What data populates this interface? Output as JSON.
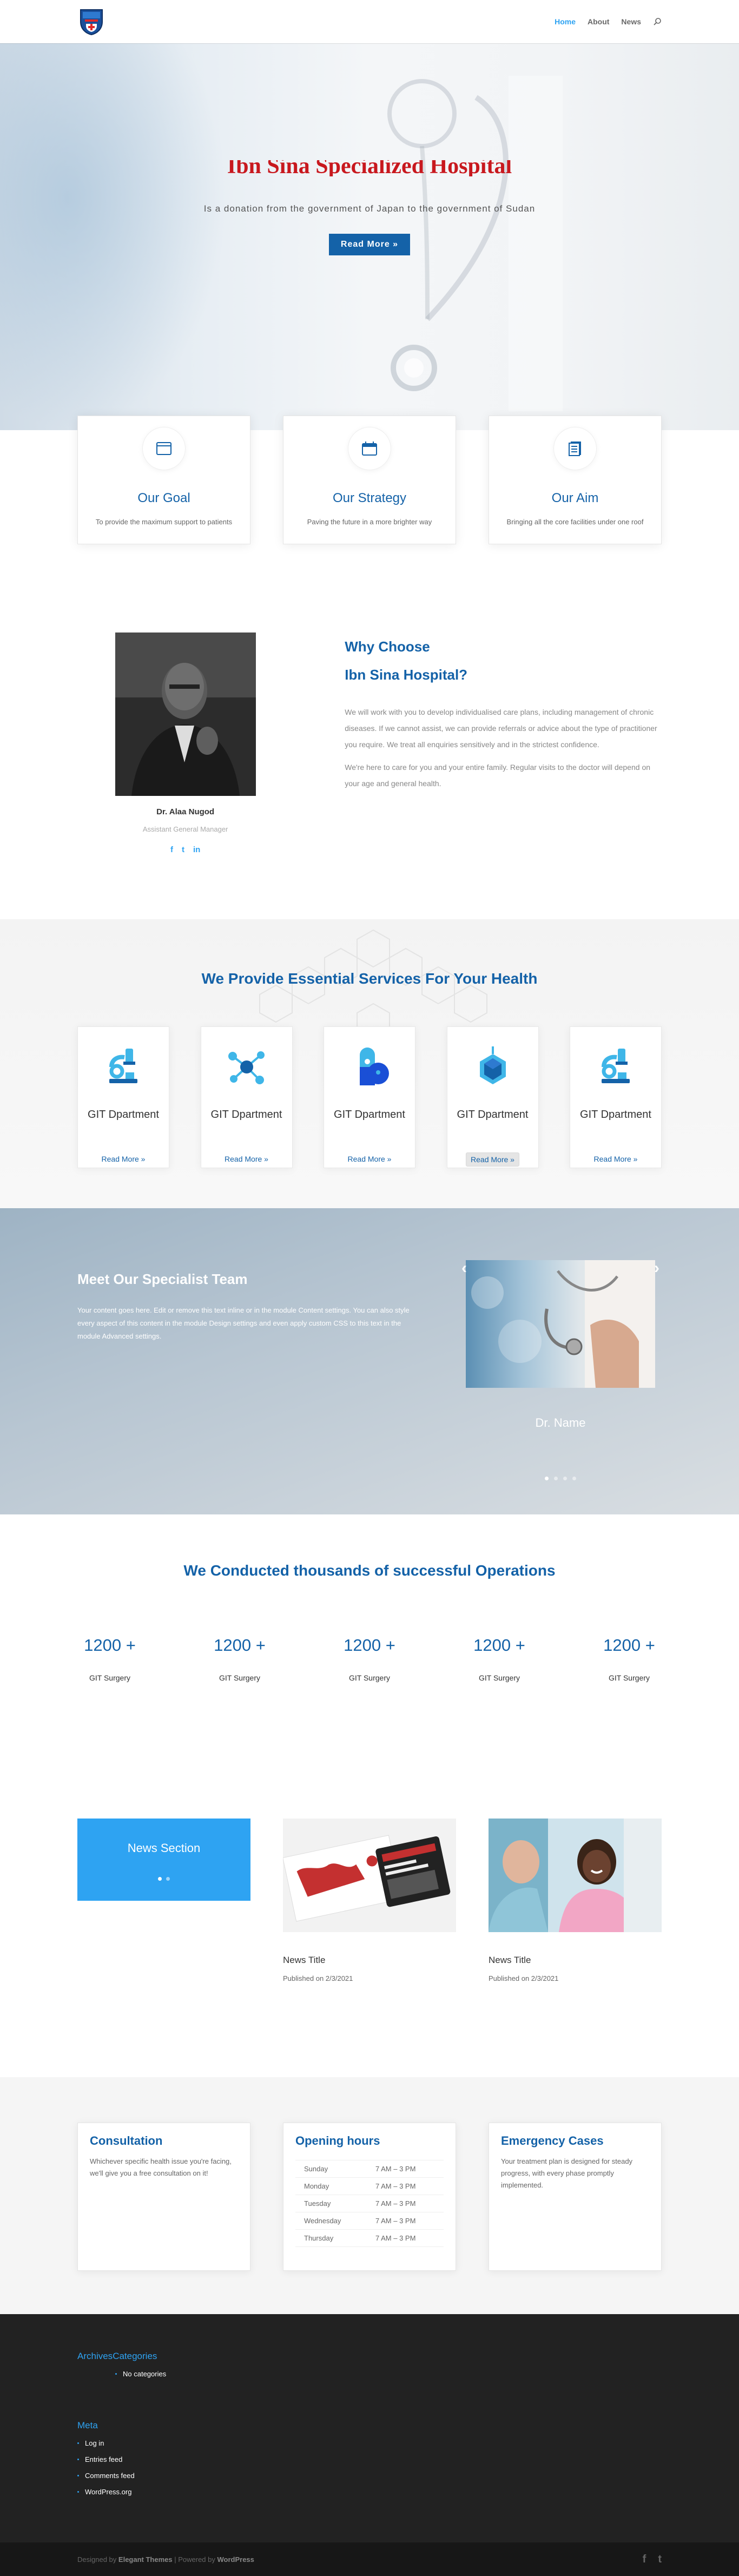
{
  "colors": {
    "primary": "#1462a8",
    "accent": "#2ea3f2",
    "hero_title": "#c8181e"
  },
  "header": {
    "logo_icon": "hospital-crest-logo",
    "nav": [
      {
        "label": "Home",
        "active": true
      },
      {
        "label": "About",
        "active": false
      },
      {
        "label": "News",
        "active": false
      }
    ],
    "search_icon": "search-icon"
  },
  "hero": {
    "title": "Ibn Sina Specialized Hospital",
    "subtitle": "Is a donation from the government of Japan to the government of Sudan",
    "button": "Read More »"
  },
  "features": [
    {
      "icon": "window-icon",
      "title": "Our Goal",
      "text": "To provide the maximum support to patients"
    },
    {
      "icon": "calendar-icon",
      "title": "Our Strategy",
      "text": "Paving the future in a more brighter way"
    },
    {
      "icon": "document-icon",
      "title": "Our Aim",
      "text": "Bringing all the core facilities under one roof"
    }
  ],
  "why": {
    "title_line1": "Why Choose",
    "title_line2": "Ibn Sina Hospital?",
    "p1": "We will work with you to develop individualised care plans, including management of chronic diseases. If we cannot assist, we can provide referrals or advice about the type of practitioner you require. We treat all enquiries sensitively and in the strictest confidence.",
    "p2": "We're here to care for you and your entire family. Regular visits to the doctor will depend on your age and general health.",
    "doctor_name": "Dr. Alaa Nugod",
    "doctor_role": "Assistant General Manager",
    "social": [
      "f",
      "t",
      "in"
    ]
  },
  "services": {
    "title": "We Provide Essential Services For Your Health",
    "items": [
      {
        "name": "GIT Dpartment",
        "link": "Read More »",
        "icon": "microscope-icon"
      },
      {
        "name": "GIT Dpartment",
        "link": "Read More »",
        "icon": "molecule-icon"
      },
      {
        "name": "GIT Dpartment",
        "link": "Read More »",
        "icon": "capsule-icon"
      },
      {
        "name": "GIT Dpartment",
        "link": "Read More »",
        "icon": "hexagon-icon"
      },
      {
        "name": "GIT Dpartment",
        "link": "Read More »",
        "icon": "microscope-icon"
      }
    ]
  },
  "team": {
    "title": "Meet Our Specialist Team",
    "text": "Your content goes here. Edit or remove this text inline or in the module Content settings. You can also style every aspect of this content in the module Design settings and even apply custom CSS to this text in the module Advanced settings.",
    "doctor_name": "Dr. Name",
    "prev": "‹",
    "next": "›"
  },
  "stats": {
    "title": "We Conducted thousands of successful Operations",
    "items": [
      {
        "number": "1200 +",
        "label": "GIT Surgery"
      },
      {
        "number": "1200 +",
        "label": "GIT Surgery"
      },
      {
        "number": "1200 +",
        "label": "GIT Surgery"
      },
      {
        "number": "1200 +",
        "label": "GIT Surgery"
      },
      {
        "number": "1200 +",
        "label": "GIT Surgery"
      }
    ]
  },
  "news": {
    "section_title": "News Section",
    "items": [
      {
        "title": "News Title",
        "date": "Published on 2/3/2021"
      },
      {
        "title": "News Title",
        "date": "Published on 2/3/2021"
      }
    ]
  },
  "info": {
    "consultation": {
      "title": "Consultation",
      "text": "Whichever specific health issue you're facing, we'll give you a free consultation on it!"
    },
    "hours": {
      "title": "Opening hours",
      "rows": [
        {
          "day": "Sunday",
          "time": "7 AM – 3 PM"
        },
        {
          "day": "Monday",
          "time": "7 AM – 3 PM"
        },
        {
          "day": "Tuesday",
          "time": "7 AM – 3 PM"
        },
        {
          "day": "Wednesday",
          "time": "7 AM – 3 PM"
        },
        {
          "day": "Thursday",
          "time": "7 AM – 3 PM"
        }
      ]
    },
    "emergency": {
      "title": "Emergency Cases",
      "text": "Your treatment plan is designed for steady progress, with every phase promptly implemented."
    }
  },
  "footer": {
    "archives_title": "Archives",
    "categories_title": "Categories",
    "no_categories": "No categories",
    "meta_title": "Meta",
    "meta_links": [
      "Log in",
      "Entries feed",
      "Comments feed",
      "WordPress.org"
    ],
    "credits_prefix": "Designed by",
    "credits_theme": "Elegant Themes",
    "credits_sep": "| Powered by",
    "credits_wp": "WordPress",
    "social": [
      "f",
      "t"
    ]
  }
}
